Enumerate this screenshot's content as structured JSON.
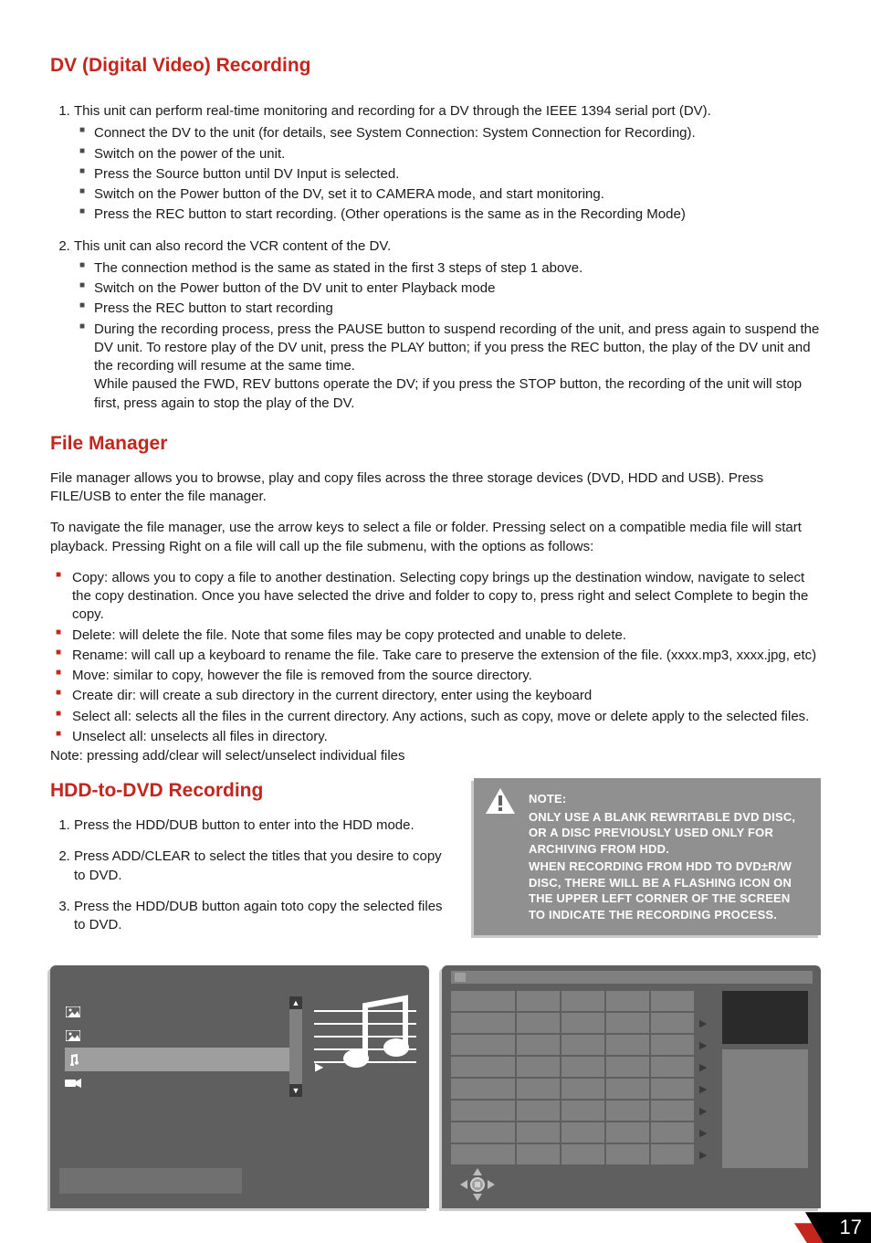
{
  "page_number": "17",
  "section1": {
    "title": "DV (Digital Video) Recording",
    "item1": {
      "lead": "This unit can perform real-time monitoring and recording for a DV through the IEEE 1394 serial port (DV).",
      "bullets": [
        "Connect the DV to the unit (for details, see System Connection: System Connection for Recording).",
        "Switch on the power of the unit.",
        "Press the Source button until DV Input is selected.",
        "Switch on the Power button of the DV, set it to CAMERA mode, and start monitoring.",
        "Press the REC button to start recording. (Other operations is the same as in the Recording Mode)"
      ]
    },
    "item2": {
      "lead": "This unit can also record the VCR content of the DV.",
      "bullets": [
        "The connection method is the same as stated in the first 3 steps of step 1 above.",
        "Switch on the Power button of the DV unit to enter Playback mode",
        "Press the REC button to start recording"
      ],
      "bullet4a": "During the recording process, press the PAUSE button to suspend recording of the unit, and press again to suspend the DV unit. To restore play of the DV unit, press the PLAY button; if you press the REC button, the play of the DV unit and the recording will resume at the same time.",
      "bullet4b": "While paused the FWD, REV buttons operate the DV; if you press the STOP button, the recording of the unit will stop first, press again to stop the play of the DV."
    }
  },
  "section2": {
    "title": "File Manager",
    "p1": "File manager allows you to browse, play and copy files across the three storage devices (DVD, HDD and USB). Press FILE/USB to enter the file manager.",
    "p2": "To navigate the file manager, use the arrow keys to select a file or folder. Pressing select on a compatible media file will start playback. Pressing Right on a file will call up the file submenu, with the options as follows:",
    "bullets": [
      "Copy: allows you to copy a file to another destination. Selecting copy brings up the destination window, navigate to select the copy destination. Once you have selected the drive and folder to copy to, press right and select Complete to begin the copy.",
      "Delete: will delete the file. Note that some files may be copy protected and unable to delete.",
      "Rename: will call up a keyboard to rename the file. Take care to preserve the extension of the file. (xxxx.mp3, xxxx.jpg, etc)",
      "Move: similar to copy, however the file is removed from the source directory.",
      "Create dir: will create a sub directory in the current directory, enter using the keyboard",
      "Select all: selects all the files in the current directory. Any actions, such as copy, move or delete apply to the selected files.",
      "Unselect all: unselects all files in directory."
    ],
    "note": "Note: pressing add/clear will select/unselect individual files"
  },
  "section3": {
    "title": "HDD-to-DVD Recording",
    "items": [
      "Press the HDD/DUB button to enter into the HDD mode.",
      "Press ADD/CLEAR to select the titles that you desire to copy to DVD.",
      "Press the HDD/DUB button again toto copy the selected files to DVD."
    ]
  },
  "notebox": {
    "label": "NOTE:",
    "line1": "ONLY USE A BLANK REWRITABLE DVD DISC, OR A DISC PREVIOUSLY USED ONLY FOR ARCHIVING FROM HDD.",
    "line2": "WHEN RECORDING FROM HDD TO DVD±R/W DISC, THERE WILL BE A FLASHING ICON ON THE UPPER LEFT CORNER OF THE SCREEN TO INDICATE THE RECORDING PROCESS."
  }
}
